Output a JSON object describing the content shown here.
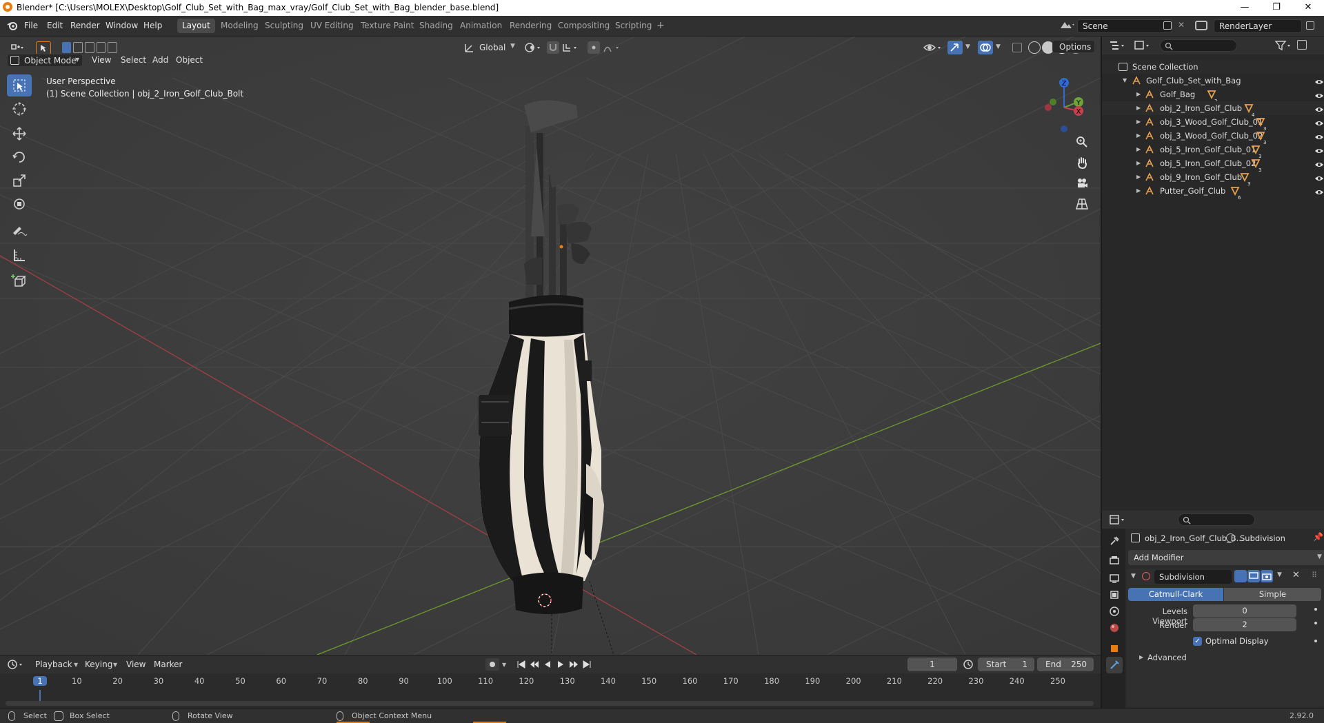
{
  "window": {
    "title": "Blender* [C:\\Users\\MOLEX\\Desktop\\Golf_Club_Set_with_Bag_max_vray/Golf_Club_Set_with_Bag_blender_base.blend]",
    "minimize": "—",
    "maximize": "❐",
    "close": "✕"
  },
  "menu": [
    "File",
    "Edit",
    "Render",
    "Window",
    "Help"
  ],
  "workspaces": [
    "Layout",
    "Modeling",
    "Sculpting",
    "UV Editing",
    "Texture Paint",
    "Shading",
    "Animation",
    "Rendering",
    "Compositing",
    "Scripting"
  ],
  "active_workspace": "Layout",
  "scene_name": "Scene",
  "view_layer": "RenderLayer",
  "viewport": {
    "mode": "Object Mode",
    "menus": [
      "View",
      "Select",
      "Add",
      "Object"
    ],
    "orientation": "Global",
    "options_label": "Options",
    "overlay_title": "User Perspective",
    "overlay_sub": "(1) Scene Collection | obj_2_Iron_Golf_Club_Bolt",
    "gizmo": {
      "z": "Z",
      "y": "Y",
      "x": "X"
    }
  },
  "tools": [
    "select-box",
    "cursor",
    "move",
    "rotate",
    "scale",
    "transform",
    "annotate",
    "measure",
    "add-cube"
  ],
  "outliner": {
    "root": "Scene Collection",
    "collection": "Golf_Club_Set_with_Bag",
    "items": [
      {
        "name": "Golf_Bag",
        "badge": "2"
      },
      {
        "name": "obj_2_Iron_Golf_Club",
        "badge": "4"
      },
      {
        "name": "obj_3_Wood_Golf_Club_01",
        "badge": "3"
      },
      {
        "name": "obj_3_Wood_Golf_Club_02",
        "badge": "3"
      },
      {
        "name": "obj_5_Iron_Golf_Club_01",
        "badge": "3"
      },
      {
        "name": "obj_5_Iron_Golf_Club_02",
        "badge": "3"
      },
      {
        "name": "obj_9_Iron_Golf_Club",
        "badge": "3"
      },
      {
        "name": "Putter_Golf_Club",
        "badge": "6"
      }
    ]
  },
  "properties": {
    "object_name": "obj_2_Iron_Golf_Club_B...",
    "modifier_tab": "Subdivision",
    "add_modifier": "Add Modifier",
    "modifier_name": "Subdivision",
    "method_a": "Catmull-Clark",
    "method_b": "Simple",
    "levels_viewport_label": "Levels Viewport",
    "levels_viewport": "0",
    "render_label": "Render",
    "render_level": "2",
    "optimal_display": "Optimal Display",
    "advanced": "Advanced"
  },
  "timeline": {
    "menus": [
      "Playback",
      "Keying",
      "View",
      "Marker"
    ],
    "current_frame": "1",
    "start_label": "Start",
    "start": "1",
    "end_label": "End",
    "end": "250",
    "ruler": [
      "1",
      "10",
      "20",
      "30",
      "40",
      "50",
      "60",
      "70",
      "80",
      "90",
      "100",
      "110",
      "120",
      "130",
      "140",
      "150",
      "160",
      "170",
      "180",
      "190",
      "200",
      "210",
      "220",
      "230",
      "240",
      "250"
    ]
  },
  "status": {
    "select": "Select",
    "box_select": "Box Select",
    "rotate_view": "Rotate View",
    "context_menu": "Object Context Menu",
    "version": "2.92.0"
  },
  "colors": {
    "accent": "#4772b3",
    "orange": "#e87d0d",
    "x_axis": "#a33f45",
    "y_axis": "#6d9a2e"
  }
}
